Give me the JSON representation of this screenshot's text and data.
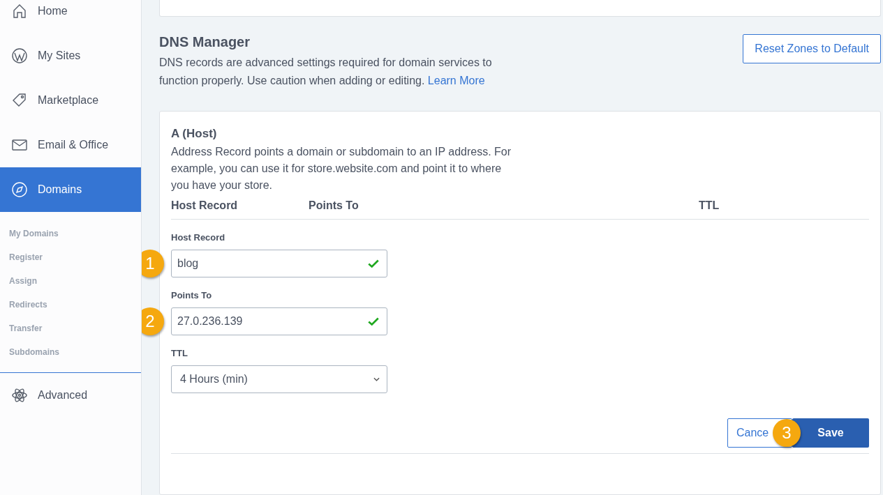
{
  "sidebar": {
    "items": [
      {
        "label": "Home",
        "selected": false
      },
      {
        "label": "My Sites",
        "selected": false
      },
      {
        "label": "Marketplace",
        "selected": false
      },
      {
        "label": "Email & Office",
        "selected": false
      },
      {
        "label": "Domains",
        "selected": true
      }
    ],
    "subitems": [
      "My Domains",
      "Register",
      "Assign",
      "Redirects",
      "Transfer",
      "Subdomains"
    ],
    "bottom_items": [
      {
        "label": "Advanced",
        "selected": false
      }
    ]
  },
  "dns_manager": {
    "title": "DNS Manager",
    "description": "DNS records are advanced settings required for domain services to function properly. Use caution when adding or editing.",
    "link": "Learn More",
    "reset_button": "Reset Zones to Default"
  },
  "record": {
    "title": "A (Host)",
    "description": "Address Record points a domain or subdomain to an IP address. For example, you can use it for store.website.com and point it to where you have your store.",
    "columns": [
      "Host Record",
      "Points To",
      "TTL"
    ],
    "fields": [
      {
        "kind": "text",
        "label": "Host Record",
        "value": "blog",
        "valid": true,
        "badge": "1"
      },
      {
        "kind": "text",
        "label": "Points To",
        "value": "27.0.236.139",
        "valid": true,
        "badge": "2"
      },
      {
        "kind": "select",
        "label": "TTL",
        "value": "4 Hours (min)"
      }
    ],
    "cancel_button": "Cance",
    "save_button": "Save",
    "button_badge": "3"
  }
}
